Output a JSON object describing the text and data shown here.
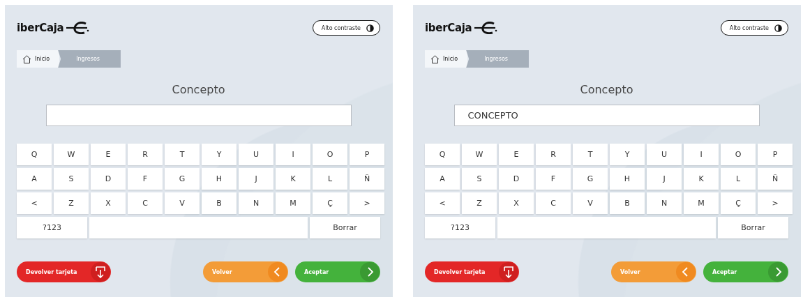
{
  "screens": [
    {
      "logo": "iberCaja",
      "contrast_button": "Alto contraste",
      "breadcrumb": [
        {
          "label": "Inicio",
          "selected": false,
          "kind": "home"
        },
        {
          "label": "Ingresos",
          "selected": true,
          "kind": "page"
        }
      ],
      "title": "Concepto",
      "keyboard": [
        [
          {
            "label": "Q"
          },
          {
            "label": "W"
          },
          {
            "label": "E"
          },
          {
            "label": "R"
          },
          {
            "label": "T"
          },
          {
            "label": "Y"
          },
          {
            "label": "U"
          },
          {
            "label": "I"
          },
          {
            "label": "O"
          },
          {
            "label": "P"
          }
        ],
        [
          {
            "label": "A"
          },
          {
            "label": "S"
          },
          {
            "label": "D"
          },
          {
            "label": "F"
          },
          {
            "label": "G"
          },
          {
            "label": "H"
          },
          {
            "label": "J"
          },
          {
            "label": "K"
          },
          {
            "label": "L"
          },
          {
            "label": "Ñ"
          }
        ],
        [
          {
            "label": "<"
          },
          {
            "label": "Z"
          },
          {
            "label": "X"
          },
          {
            "label": "C"
          },
          {
            "label": "V"
          },
          {
            "label": "B"
          },
          {
            "label": "N"
          },
          {
            "label": "M"
          },
          {
            "label": "Ç"
          },
          {
            "label": ">"
          }
        ],
        [
          {
            "label": "?123",
            "kind": "wide"
          },
          {
            "kind": "space"
          },
          {
            "label": "Borrar",
            "kind": "wide"
          }
        ]
      ],
      "actions": [
        {
          "label": "Devolver tarjeta",
          "kind": "eject"
        },
        {
          "label": "Volver",
          "kind": "back"
        },
        {
          "label": "Aceptar",
          "kind": "accept"
        }
      ]
    },
    {
      "logo": "iberCaja",
      "contrast_button": "Alto contraste",
      "breadcrumb": [
        {
          "label": "Inicio",
          "selected": false,
          "kind": "home"
        },
        {
          "label": "Ingresos",
          "selected": true,
          "kind": "page"
        }
      ],
      "title": "Concepto",
      "field": {
        "value": "CONCEPTO"
      },
      "keyboard": [
        [
          {
            "label": "Q"
          },
          {
            "label": "W"
          },
          {
            "label": "E"
          },
          {
            "label": "R"
          },
          {
            "label": "T"
          },
          {
            "label": "Y"
          },
          {
            "label": "U"
          },
          {
            "label": "I"
          },
          {
            "label": "O"
          },
          {
            "label": "P"
          }
        ],
        [
          {
            "label": "A"
          },
          {
            "label": "S"
          },
          {
            "label": "D"
          },
          {
            "label": "F"
          },
          {
            "label": "G"
          },
          {
            "label": "H"
          },
          {
            "label": "J"
          },
          {
            "label": "K"
          },
          {
            "label": "L"
          },
          {
            "label": "Ñ"
          }
        ],
        [
          {
            "label": "<"
          },
          {
            "label": "Z"
          },
          {
            "label": "X"
          },
          {
            "label": "C"
          },
          {
            "label": "V"
          },
          {
            "label": "B"
          },
          {
            "label": "N"
          },
          {
            "label": "M"
          },
          {
            "label": "Ç"
          },
          {
            "label": ">"
          }
        ],
        [
          {
            "label": "?123",
            "kind": "wide"
          },
          {
            "kind": "space"
          },
          {
            "label": "Borrar",
            "kind": "wide"
          }
        ]
      ],
      "actions": [
        {
          "label": "Devolver tarjeta",
          "kind": "eject"
        },
        {
          "label": "Volver",
          "kind": "back"
        },
        {
          "label": "Aceptar",
          "kind": "accept"
        }
      ]
    }
  ]
}
